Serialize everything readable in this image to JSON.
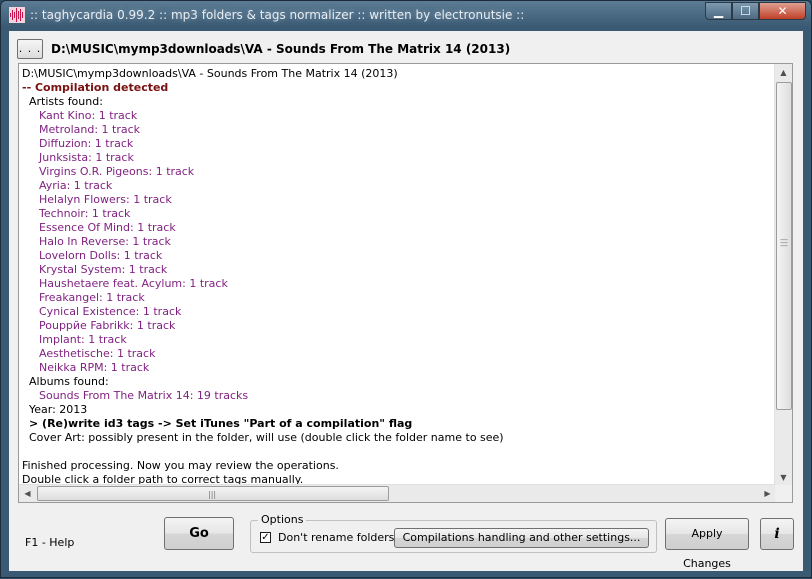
{
  "window": {
    "title": ":: taghycardia 0.99.2 :: mp3 folders & tags normalizer :: written by electronutsie ::",
    "caption_buttons": {
      "minimize": "▁",
      "maximize": "☐",
      "close": "✕"
    }
  },
  "path_bar": {
    "browse_label": ". . .",
    "path": "D:\\MUSIC\\mymp3downloads\\VA - Sounds From The Matrix 14 (2013)"
  },
  "log": {
    "lines": [
      {
        "text": "D:\\MUSIC\\mymp3downloads\\VA - Sounds From The Matrix 14 (2013)",
        "indent": 0,
        "style": "normal"
      },
      {
        "text": " -- Compilation detected",
        "indent": 0,
        "style": "compil"
      },
      {
        "text": "Artists found:",
        "indent": 1,
        "style": "normal"
      },
      {
        "text": "Kant Kino: 1 track",
        "indent": 2,
        "style": "artist"
      },
      {
        "text": "Metroland: 1 track",
        "indent": 2,
        "style": "artist"
      },
      {
        "text": "Diffuzion: 1 track",
        "indent": 2,
        "style": "artist"
      },
      {
        "text": "Junksista: 1 track",
        "indent": 2,
        "style": "artist"
      },
      {
        "text": "Virgins O.R. Pigeons: 1 track",
        "indent": 2,
        "style": "artist"
      },
      {
        "text": "Ayria: 1 track",
        "indent": 2,
        "style": "artist"
      },
      {
        "text": "Helalyn Flowers: 1 track",
        "indent": 2,
        "style": "artist"
      },
      {
        "text": "Technoir: 1 track",
        "indent": 2,
        "style": "artist"
      },
      {
        "text": "Essence Of Mind: 1 track",
        "indent": 2,
        "style": "artist"
      },
      {
        "text": "Halo In Reverse: 1 track",
        "indent": 2,
        "style": "artist"
      },
      {
        "text": "Lovelorn Dolls: 1 track",
        "indent": 2,
        "style": "artist"
      },
      {
        "text": "Krystal System: 1 track",
        "indent": 2,
        "style": "artist"
      },
      {
        "text": "Haushetaere feat. Acylum: 1 track",
        "indent": 2,
        "style": "artist"
      },
      {
        "text": "Freakangel: 1 track",
        "indent": 2,
        "style": "artist"
      },
      {
        "text": "Cynical Existence: 1 track",
        "indent": 2,
        "style": "artist"
      },
      {
        "text": "Pouppйe Fabrikk: 1 track",
        "indent": 2,
        "style": "artist"
      },
      {
        "text": "Implant: 1 track",
        "indent": 2,
        "style": "artist"
      },
      {
        "text": "Aesthetische: 1 track",
        "indent": 2,
        "style": "artist"
      },
      {
        "text": "Neikka RPM: 1 track",
        "indent": 2,
        "style": "artist"
      },
      {
        "text": "Albums found:",
        "indent": 1,
        "style": "normal"
      },
      {
        "text": "Sounds From The Matrix 14: 19 tracks",
        "indent": 2,
        "style": "artist"
      },
      {
        "text": "Year: 2013",
        "indent": 1,
        "style": "normal"
      },
      {
        "text": "> (Re)write id3 tags  -> Set iTunes \"Part of a compilation\" flag",
        "indent": 1,
        "style": "bold"
      },
      {
        "text": "Cover Art: possibly present in the folder, will use (double click the folder name to see)",
        "indent": 1,
        "style": "normal"
      },
      {
        "text": "",
        "indent": 0,
        "style": "normal"
      },
      {
        "text": "Finished processing. Now you may review the operations.",
        "indent": 0,
        "style": "normal"
      },
      {
        "text": "Double click a folder path to correct tags manually.",
        "indent": 0,
        "style": "normal"
      }
    ]
  },
  "footer": {
    "help": "F1 - Help",
    "go_label": "Go",
    "options_legend": "Options",
    "dont_rename_label": "Don't rename folders",
    "dont_rename_checked": true,
    "settings_label": "Compilations handling and other settings...",
    "apply_label": "Apply Changes",
    "info_label": "i"
  },
  "colors": {
    "artist": "#7f1f7f",
    "compilation": "#7a1010"
  }
}
